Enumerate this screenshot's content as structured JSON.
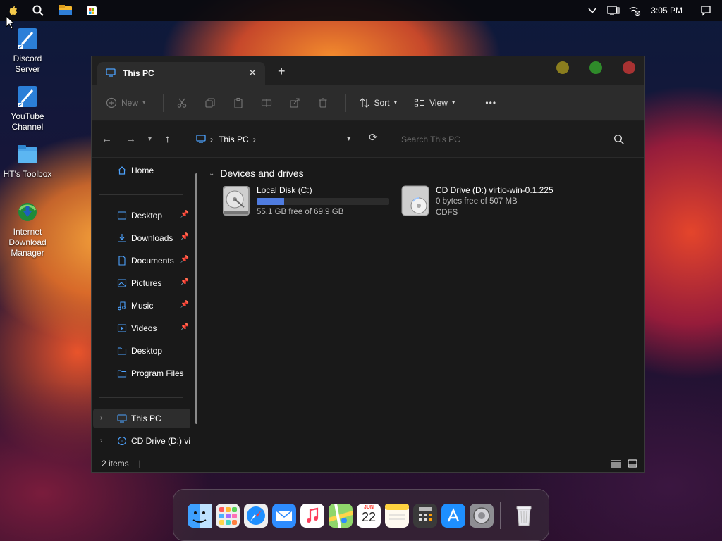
{
  "taskbar": {
    "time": "3:05 PM",
    "icons": [
      "apple-icon",
      "search-icon",
      "file-explorer-icon",
      "store-icon",
      "chevron-down-icon",
      "device-icon",
      "network-icon",
      "notification-icon"
    ]
  },
  "desktop_icons": [
    {
      "label": "Discord Server",
      "icon": "discord-server-shortcut-icon"
    },
    {
      "label": "YouTube Channel",
      "icon": "youtube-channel-shortcut-icon"
    },
    {
      "label": "HT's Toolbox",
      "icon": "folder-icon"
    },
    {
      "label": "Internet Download Manager",
      "icon": "idm-icon"
    }
  ],
  "window": {
    "tab_title": "This PC",
    "toolbar": {
      "new_label": "New",
      "sort_label": "Sort",
      "view_label": "View",
      "more_label": "•••"
    },
    "address": {
      "crumb": "This PC",
      "search_placeholder": "Search This PC"
    },
    "sidebar": {
      "home": "Home",
      "quick_access": [
        {
          "label": "Desktop",
          "pinned": true
        },
        {
          "label": "Downloads",
          "pinned": true
        },
        {
          "label": "Documents",
          "pinned": true
        },
        {
          "label": "Pictures",
          "pinned": true
        },
        {
          "label": "Music",
          "pinned": true
        },
        {
          "label": "Videos",
          "pinned": true
        },
        {
          "label": "Desktop",
          "pinned": false
        },
        {
          "label": "Program Files",
          "pinned": false
        }
      ],
      "this_pc": "This PC",
      "cd_drive": "CD Drive (D:) vir"
    },
    "content": {
      "section_title": "Devices and drives",
      "drives": [
        {
          "name": "Local Disk (C:)",
          "free_text": "55.1 GB free of 69.9 GB",
          "used_fraction": 0.21
        },
        {
          "name": "CD Drive (D:) virtio-win-0.1.225",
          "free_text": "0 bytes free of 507 MB",
          "filesystem": "CDFS"
        }
      ]
    },
    "status": {
      "items": "2 items",
      "caret": "|"
    }
  },
  "dock": {
    "apps": [
      "finder-icon",
      "launchpad-icon",
      "safari-icon",
      "mail-icon",
      "music-icon",
      "maps-icon",
      "calendar-icon",
      "notes-icon",
      "calculator-icon",
      "app-store-icon",
      "system-preferences-icon",
      "trash-icon"
    ],
    "calendar_month": "JUN",
    "calendar_day": "22"
  }
}
